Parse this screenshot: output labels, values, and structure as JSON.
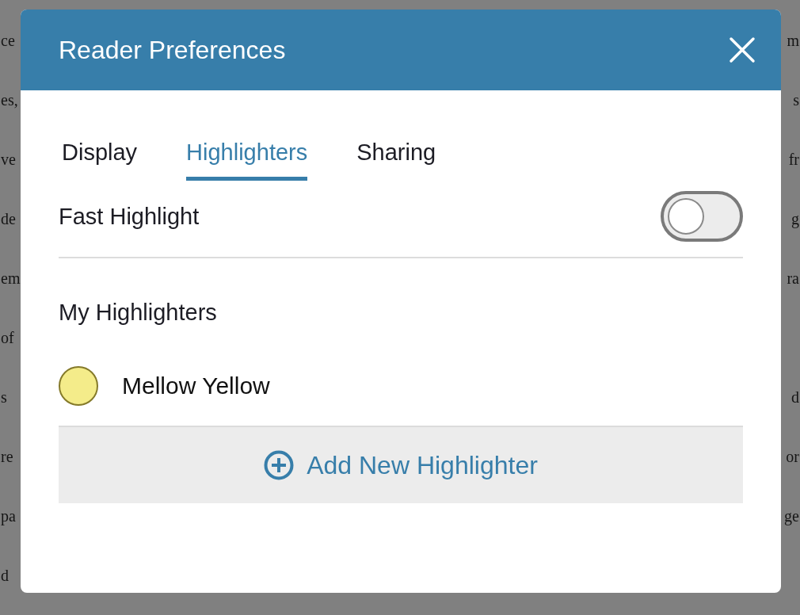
{
  "background_text": [
    {
      "left": "ce",
      "right": "m"
    },
    {
      "left": "es,",
      "right": "s"
    },
    {
      "left": "ve",
      "right": "fr"
    },
    {
      "left": "de",
      "right": "g"
    },
    {
      "left": "em",
      "right": "ra"
    },
    {
      "left": "of"
    },
    {
      "left": "s",
      "right": "d"
    },
    {
      "left": "re",
      "right": "or"
    },
    {
      "left": "pa",
      "right": "ge"
    },
    {
      "left": "d"
    }
  ],
  "dialog": {
    "title": "Reader Preferences",
    "tabs": [
      {
        "label": "Display",
        "selected": false
      },
      {
        "label": "Highlighters",
        "selected": true
      },
      {
        "label": "Sharing",
        "selected": false
      }
    ],
    "fast_highlight": {
      "label": "Fast Highlight",
      "on": false
    },
    "section_title": "My Highlighters",
    "highlighters": [
      {
        "name": "Mellow Yellow",
        "color": "#f4ec8a"
      }
    ],
    "add_button": "Add New Highlighter"
  }
}
